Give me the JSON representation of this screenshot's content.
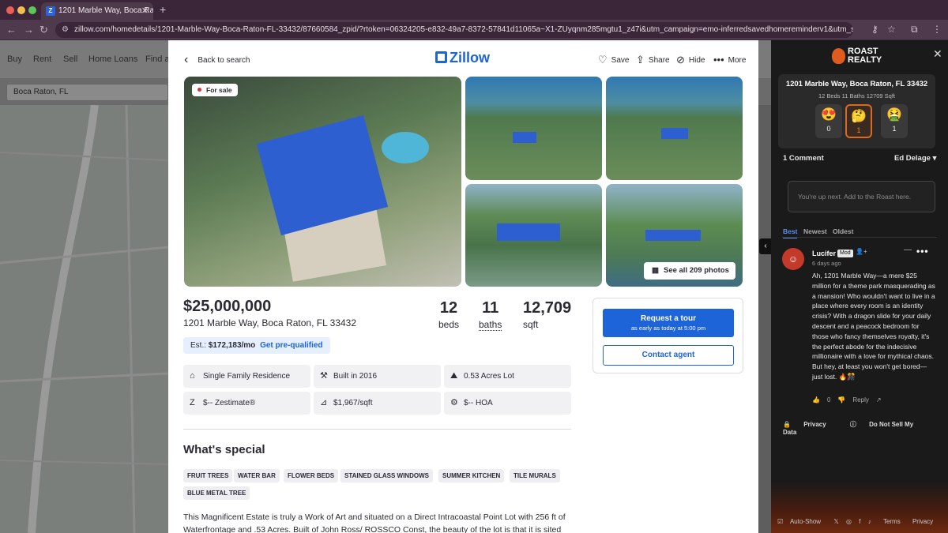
{
  "browser": {
    "tab_title": "1201 Marble Way, Boca Raton",
    "tab_favicon": "Z",
    "url": "zillow.com/homedetails/1201-Marble-Way-Boca-Raton-FL-33432/87660584_zpid/?rtoken=06324205-e832-49a7-8372-57841d11065a~X1-ZUyqnm285mgtu1_z47i&utm_campaign=emo-inferredsavedhomereminderv1&utm_source=email&utm_term=u..."
  },
  "bg": {
    "nav": [
      "Buy",
      "Rent",
      "Sell",
      "Home Loans",
      "Find a"
    ],
    "search_value": "Boca Raton, FL"
  },
  "header": {
    "back_label": "Back to search",
    "logo": "Zillow",
    "save_label": "Save",
    "share_label": "Share",
    "hide_label": "Hide",
    "more_label": "More"
  },
  "photos": {
    "badge": "For sale",
    "see_all": "See all 209 photos"
  },
  "listing": {
    "price": "$25,000,000",
    "address": "1201 Marble Way, Boca Raton, FL 33432",
    "beds": "12",
    "beds_label": "beds",
    "baths": "11",
    "baths_label": "baths",
    "sqft": "12,709",
    "sqft_label": "sqft",
    "est_prefix": "Est.:",
    "est_value": "$172,183/mo",
    "prequal": "Get pre-qualified"
  },
  "facts": [
    {
      "icon": "house-icon",
      "text": "Single Family Residence"
    },
    {
      "icon": "hammer-icon",
      "text": "Built in 2016"
    },
    {
      "icon": "lot-icon",
      "text": "0.53 Acres Lot"
    },
    {
      "icon": "zestimate-icon",
      "text": "$-- Zestimate®"
    },
    {
      "icon": "price-per-sqft-icon",
      "text": "$1,967/sqft"
    },
    {
      "icon": "hoa-icon",
      "text": "$-- HOA"
    }
  ],
  "special": {
    "title": "What's special",
    "tags": [
      "FRUIT TREES",
      "WATER BAR",
      "FLOWER BEDS",
      "STAINED GLASS WINDOWS",
      "SUMMER KITCHEN",
      "TILE MURALS",
      "BLUE METAL TREE"
    ],
    "description": "This Magnificent Estate is truly a Work of Art and situated on a Direct Intracoastal Point Lot with 256 ft of Waterfrontage and .53 Acres. Built of John Ross/ ROSSCO Const, the beauty of the lot is that it is sited on an"
  },
  "tour": {
    "request_label": "Request a tour",
    "request_sub": "as early as today at 5:00 pm",
    "contact_label": "Contact agent"
  },
  "roast": {
    "logo_line1": "ROAST",
    "logo_line2": "REALTY",
    "address": "1201 Marble Way, Boca Raton, FL 33432",
    "meta": "12 Beds   11 Baths   12709 Sqft",
    "reactions": [
      {
        "icon": "heart-eyes-icon",
        "glyph": "😍",
        "count": "0"
      },
      {
        "icon": "thinking-icon",
        "glyph": "🤔",
        "count": "1"
      },
      {
        "icon": "nauseated-icon",
        "glyph": "🤮",
        "count": "1"
      }
    ],
    "comment_count": "1 Comment",
    "user": "Ed Delage",
    "comment_placeholder": "You're up next. Add to the Roast here.",
    "sort": [
      "Best",
      "Newest",
      "Oldest"
    ],
    "comment": {
      "author": "Lucifer",
      "badge": "Mod",
      "time": "6 days ago",
      "text": "Ah, 1201 Marble Way—a mere $25 million for a theme park masquerading as a mansion! Who wouldn't want to live in a place where every room is an identity crisis? With a dragon slide for your daily descent and a peacock bedroom for those who fancy themselves royalty, it's the perfect abode for the indecisive millionaire with a love for mythical chaos. But hey, at least you won't get bored—just lost. 🔥🎊",
      "votes": "0",
      "reply": "Reply"
    },
    "privacy": "Privacy",
    "dnsmpi": "Do Not Sell My Data",
    "auto_show": "Auto-Show",
    "terms": "Terms",
    "privacy_footer": "Privacy"
  },
  "colors": {
    "zillow_blue": "#1c64d8",
    "roast_bg": "#1a1a1a",
    "accent_orange": "#d86a24"
  }
}
